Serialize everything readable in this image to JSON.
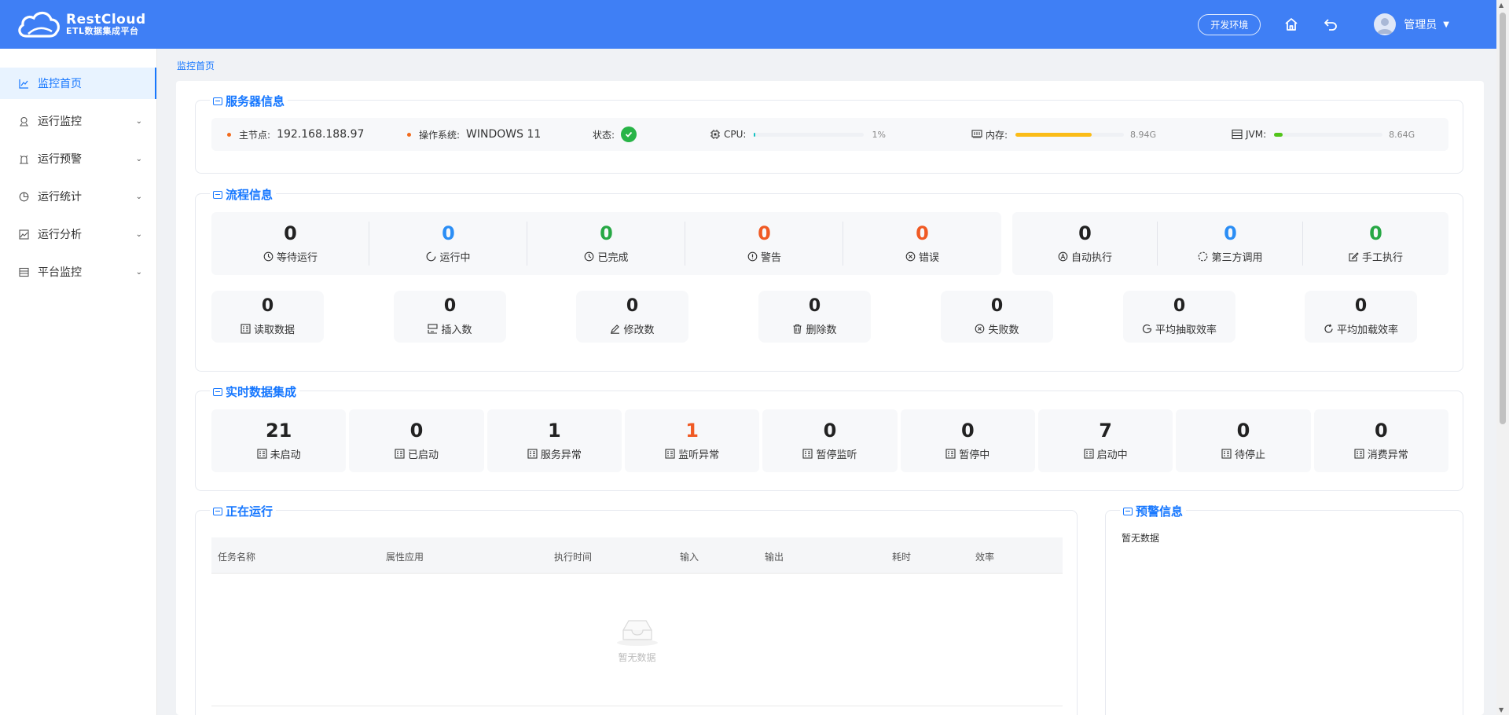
{
  "header": {
    "logo_name": "RestCloud",
    "logo_sub": "ETL数据集成平台",
    "env_label": "开发环境",
    "user_name": "管理员"
  },
  "sidebar": {
    "items": [
      {
        "label": "监控首页",
        "icon": "chart-line-icon"
      },
      {
        "label": "运行监控",
        "icon": "location-pin-icon"
      },
      {
        "label": "运行预警",
        "icon": "alarm-icon"
      },
      {
        "label": "运行统计",
        "icon": "pie-chart-icon"
      },
      {
        "label": "运行分析",
        "icon": "area-chart-icon"
      },
      {
        "label": "平台监控",
        "icon": "server-icon"
      }
    ]
  },
  "breadcrumb": "监控首页",
  "server": {
    "title": "服务器信息",
    "master_label": "主节点:",
    "master_value": "192.168.188.97",
    "os_label": "操作系统:",
    "os_value": "WINDOWS 11",
    "status_label": "状态:",
    "cpu_label": "CPU:",
    "cpu_value": "1%",
    "cpu_percent": 1,
    "mem_label": "内存:",
    "mem_value": "8.94G",
    "mem_percent": 70,
    "jvm_label": "JVM:",
    "jvm_value": "8.64G",
    "jvm_percent": 8,
    "colors": {
      "cpu": "#13c2c2",
      "mem": "#fbbc17",
      "jvm": "#52c41a"
    }
  },
  "flow": {
    "title": "流程信息",
    "status_stats": [
      {
        "value": "0",
        "label": "等待运行",
        "color": "black"
      },
      {
        "value": "0",
        "label": "运行中",
        "color": "blue"
      },
      {
        "value": "0",
        "label": "已完成",
        "color": "green"
      },
      {
        "value": "0",
        "label": "警告",
        "color": "orange"
      },
      {
        "value": "0",
        "label": "错误",
        "color": "orange"
      }
    ],
    "exec_stats": [
      {
        "value": "0",
        "label": "自动执行",
        "color": "black"
      },
      {
        "value": "0",
        "label": "第三方调用",
        "color": "blue"
      },
      {
        "value": "0",
        "label": "手工执行",
        "color": "green"
      }
    ],
    "data_stats": [
      {
        "value": "0",
        "label": "读取数据"
      },
      {
        "value": "0",
        "label": "插入数"
      },
      {
        "value": "0",
        "label": "修改数"
      },
      {
        "value": "0",
        "label": "删除数"
      },
      {
        "value": "0",
        "label": "失败数"
      },
      {
        "value": "0",
        "label": "平均抽取效率"
      },
      {
        "value": "0",
        "label": "平均加载效率"
      }
    ]
  },
  "realtime": {
    "title": "实时数据集成",
    "stats": [
      {
        "value": "21",
        "label": "未启动",
        "color": "black"
      },
      {
        "value": "0",
        "label": "已启动",
        "color": "black"
      },
      {
        "value": "1",
        "label": "服务异常",
        "color": "black"
      },
      {
        "value": "1",
        "label": "监听异常",
        "color": "orange"
      },
      {
        "value": "0",
        "label": "暂停监听",
        "color": "black"
      },
      {
        "value": "0",
        "label": "暂停中",
        "color": "black"
      },
      {
        "value": "7",
        "label": "启动中",
        "color": "black"
      },
      {
        "value": "0",
        "label": "待停止",
        "color": "black"
      },
      {
        "value": "0",
        "label": "消费异常",
        "color": "black"
      }
    ]
  },
  "running": {
    "title": "正在运行",
    "columns": [
      "任务名称",
      "属性应用",
      "执行时间",
      "输入",
      "输出",
      "耗时",
      "效率"
    ],
    "empty_text": "暂无数据"
  },
  "alerts": {
    "title": "预警信息",
    "empty_text": "暂无数据"
  }
}
